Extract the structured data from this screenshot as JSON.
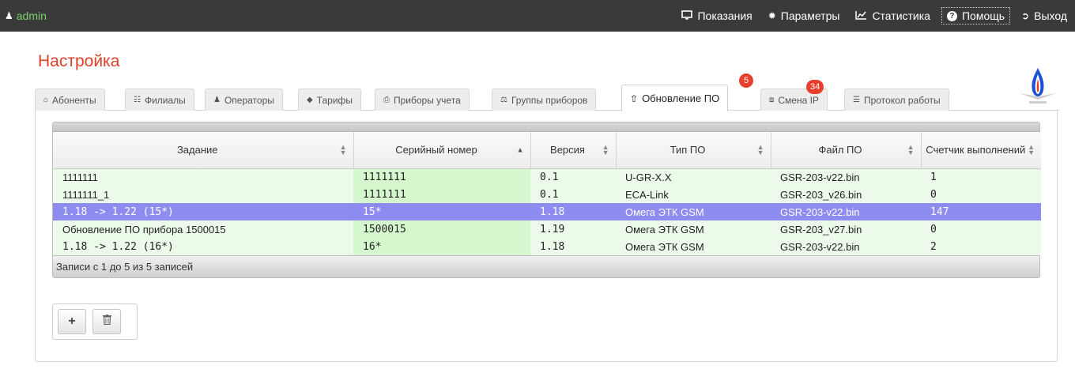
{
  "navbar": {
    "user": "admin",
    "items": [
      {
        "label": "Показания",
        "icon": "monitor-icon"
      },
      {
        "label": "Параметры",
        "icon": "gear-icon"
      },
      {
        "label": "Статистика",
        "icon": "chart-icon"
      },
      {
        "label": "Помощь",
        "icon": "help-icon"
      },
      {
        "label": "Выход",
        "icon": "logout-icon"
      }
    ]
  },
  "page_title": "Настройка",
  "tabs": [
    {
      "label": "Абоненты",
      "icon": "home-icon"
    },
    {
      "label": "Филиалы",
      "icon": "sitemap-icon"
    },
    {
      "label": "Операторы",
      "icon": "user-icon"
    },
    {
      "label": "Тарифы",
      "icon": "tag-icon"
    },
    {
      "label": "Приборы учета",
      "icon": "print-icon"
    },
    {
      "label": "Группы приборов",
      "icon": "balance-icon"
    },
    {
      "label": "Обновление ПО",
      "icon": "upload-icon",
      "active": true,
      "badge": "5"
    },
    {
      "label": "Смена IP",
      "icon": "rss-icon",
      "badge": "34"
    },
    {
      "label": "Протокол работы",
      "icon": "list-icon"
    }
  ],
  "table": {
    "columns": [
      "Задание",
      "Серийный номер",
      "Версия",
      "Тип ПО",
      "Файл ПО",
      "Счетчик выполнений"
    ],
    "rows": [
      [
        "1111111",
        "1111111",
        "0.1",
        "U-GR-X.X",
        "GSR-203-v22.bin",
        "1"
      ],
      [
        "1111111_1",
        "1111111",
        "0.1",
        "ECA-Link",
        "GSR-203_v26.bin",
        "0"
      ],
      [
        "1.18 -> 1.22 (15*)",
        "15*",
        "1.18",
        "Омега ЭТК GSM",
        "GSR-203-v22.bin",
        "147"
      ],
      [
        "Обновление ПО прибора 1500015",
        "1500015",
        "1.19",
        "Омега ЭТК GSM",
        "GSR-203_v27.bin",
        "0"
      ],
      [
        "1.18 -> 1.22 (16*)",
        "16*",
        "1.18",
        "Омега ЭТК GSM",
        "GSR-203-v22.bin",
        "2"
      ]
    ],
    "selected_row": 2,
    "footer": "Записи с 1 до 5 из 5 записей"
  },
  "actions": {
    "add": "+",
    "delete": "🗑"
  },
  "colors": {
    "navbar": "#3a3a3a",
    "title": "#e0402a",
    "badge": "#e8402f",
    "selected_row": "#8e8cf0",
    "row_light": "#ecfbe9",
    "user": "#7ad36b"
  }
}
